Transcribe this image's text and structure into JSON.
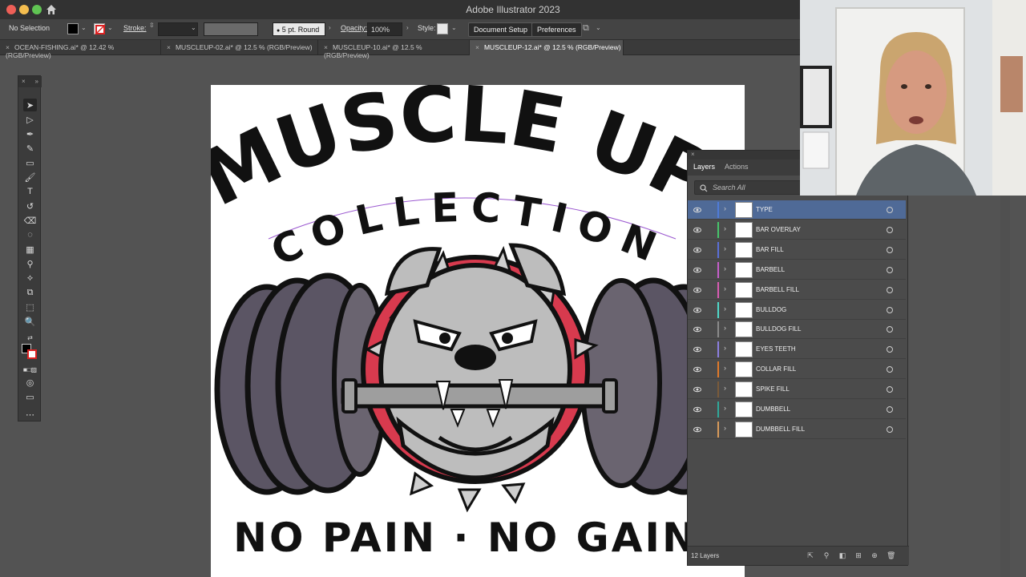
{
  "app": {
    "title": "Adobe Illustrator 2023"
  },
  "controlbar": {
    "selection": "No Selection",
    "stroke_label": "Stroke:",
    "brush": "5 pt. Round",
    "opacity_label": "Opacity:",
    "opacity_value": "100%",
    "style_label": "Style:",
    "document_setup": "Document Setup",
    "preferences": "Preferences"
  },
  "tabs": [
    {
      "label": "OCEAN-FISHING.ai* @ 12.42 % (RGB/Preview)",
      "active": false
    },
    {
      "label": "MUSCLEUP-02.ai* @ 12.5 % (RGB/Preview)",
      "active": false
    },
    {
      "label": "MUSCLEUP-10.ai* @ 12.5 % (RGB/Preview)",
      "active": false
    },
    {
      "label": "MUSCLEUP-12.ai* @ 12.5 % (RGB/Preview)",
      "active": true
    }
  ],
  "artwork": {
    "headline": "MUSCLE UP",
    "subhead": "COLLECTION",
    "tagline": "NO PAIN · NO GAIN"
  },
  "layers_panel": {
    "tabs": [
      "Layers",
      "Actions"
    ],
    "search_placeholder": "Search All",
    "layers": [
      {
        "name": "TYPE",
        "color": "#4f7bd8",
        "selected": true
      },
      {
        "name": "BAR OVERLAY",
        "color": "#46c46a",
        "selected": false
      },
      {
        "name": "BAR FILL",
        "color": "#5a6fd8",
        "selected": false
      },
      {
        "name": "BARBELL",
        "color": "#c55ec9",
        "selected": false
      },
      {
        "name": "BARBELL FILL",
        "color": "#d85bb3",
        "selected": false
      },
      {
        "name": "BULLDOG",
        "color": "#4fd8c8",
        "selected": false
      },
      {
        "name": "BULLDOG FILL",
        "color": "#8a8a8a",
        "selected": false
      },
      {
        "name": "EYES TEETH",
        "color": "#8c7fe0",
        "selected": false
      },
      {
        "name": "COLLAR FILL",
        "color": "#e07a2a",
        "selected": false
      },
      {
        "name": "SPIKE FILL",
        "color": "#7a5a3a",
        "selected": false
      },
      {
        "name": "DUMBBELL",
        "color": "#2fa89a",
        "selected": false
      },
      {
        "name": "DUMBBELL FILL",
        "color": "#d89a5a",
        "selected": false
      }
    ],
    "layer_count": "12 Layers"
  }
}
